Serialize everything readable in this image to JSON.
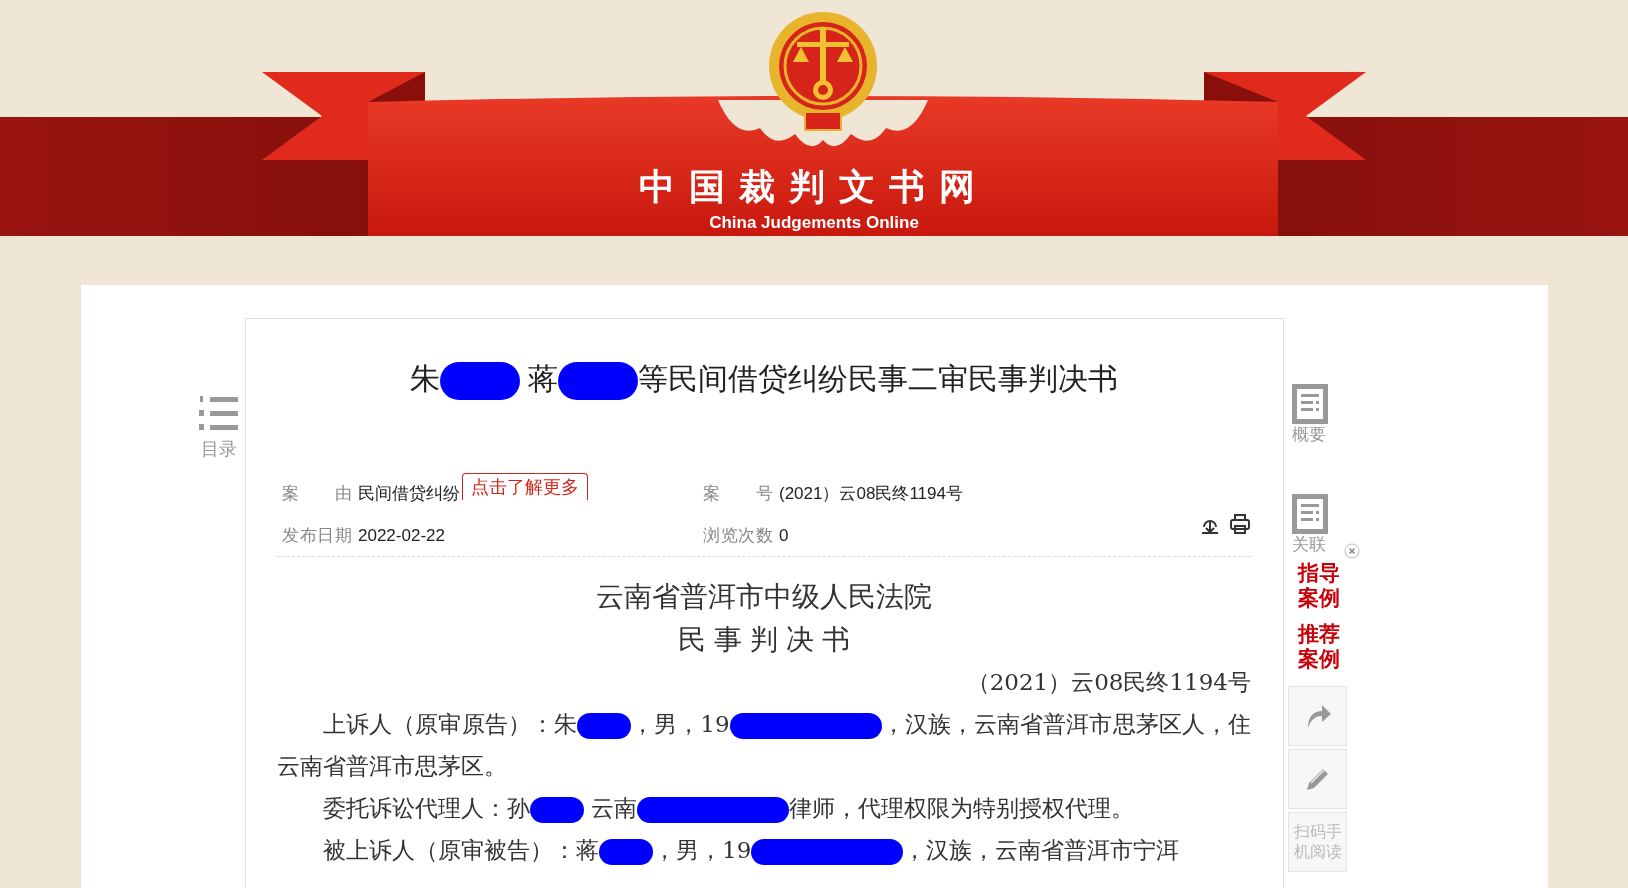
{
  "header": {
    "site_title": "中国裁判文书网",
    "site_subtitle": "China Judgements Online"
  },
  "toc": {
    "label": "目录"
  },
  "document": {
    "title": [
      {
        "kind": "text",
        "text": "朱"
      },
      {
        "kind": "redacted_short"
      },
      {
        "kind": "text",
        "text": " 蒋"
      },
      {
        "kind": "redacted_short"
      },
      {
        "kind": "text",
        "text": "等民间借贷纠纷民事二审民事判决书"
      }
    ],
    "meta": {
      "cause_label": "案 由",
      "cause_value": "民间借贷纠纷",
      "more_link": "点击了解更多",
      "case_no_label": "案 号",
      "case_no_value": "(2021）云08民终1194号",
      "date_label": "发布日期",
      "date_value": "2022-02-22",
      "views_label": "浏览次数",
      "views_value": "0"
    },
    "court": "云南省普洱市中级人民法院",
    "doc_type": "民 事 判 决 书",
    "case_number": "（2021）云08民终1194号",
    "paragraphs": [
      [
        {
          "kind": "text",
          "text": "上诉人（原审原告）：朱"
        },
        {
          "kind": "redacted_short"
        },
        {
          "kind": "text",
          "text": "，男，19"
        },
        {
          "kind": "redacted_long"
        },
        {
          "kind": "text",
          "text": "，汉族，云南省普洱市思茅区人，住云南省普洱市思茅区。"
        }
      ],
      [
        {
          "kind": "text",
          "text": "委托诉讼代理人：孙"
        },
        {
          "kind": "redacted_short"
        },
        {
          "kind": "text",
          "text": " 云南"
        },
        {
          "kind": "redacted_long"
        },
        {
          "kind": "text",
          "text": "律师，代理权限为特别授权代理。"
        }
      ],
      [
        {
          "kind": "text",
          "text": "被上诉人（原审被告）：蒋"
        },
        {
          "kind": "redacted_short"
        },
        {
          "kind": "text",
          "text": "，男，19"
        },
        {
          "kind": "redacted_long"
        },
        {
          "kind": "text",
          "text": "，汉族，云南省普洱市宁洱"
        }
      ]
    ]
  },
  "sidebar": {
    "summary_label": "概要",
    "related_label": "关联",
    "related_closable": true,
    "guiding_cases": "指导案例",
    "recommended_cases": "推荐案例",
    "scan_read": "扫码手机阅读"
  }
}
